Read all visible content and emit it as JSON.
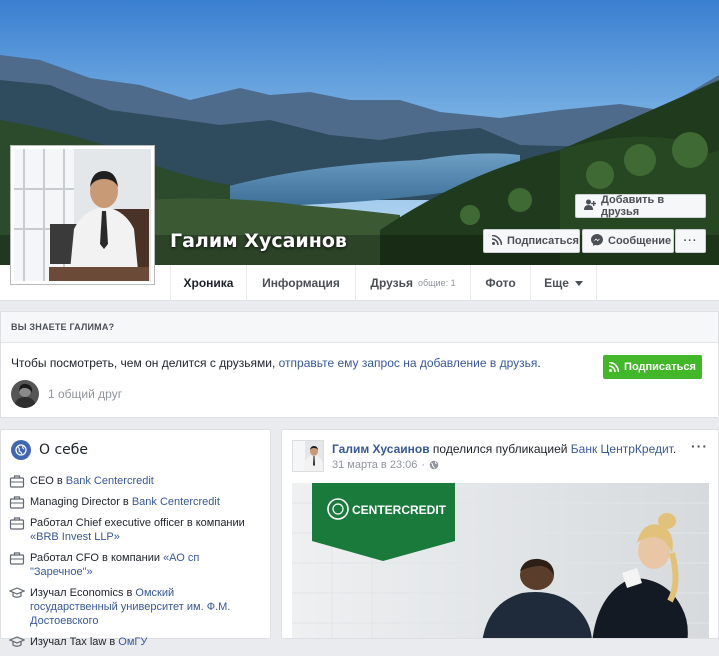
{
  "profile": {
    "name": "Галим Хусаинов"
  },
  "cover_actions": {
    "add_friend": "Добавить в друзья",
    "follow": "Подписаться",
    "message": "Сообщение",
    "more": "···"
  },
  "nav": {
    "tabs": [
      {
        "label": "Хроника"
      },
      {
        "label": "Информация"
      },
      {
        "label": "Друзья",
        "sub": "общие: 1"
      },
      {
        "label": "Фото"
      },
      {
        "label": "Еще"
      }
    ]
  },
  "know_box": {
    "heading": "ВЫ ЗНАЕТЕ ГАЛИМА?",
    "text_prefix": "Чтобы посмотреть, чем он делится с друзьями, ",
    "text_link": "отправьте ему запрос на добавление в друзья",
    "text_suffix": ".",
    "subscribe_button": "Подписаться",
    "mutual_friends": "1 общий друг"
  },
  "about": {
    "title": "О себе",
    "items": [
      {
        "icon": "briefcase-icon",
        "prefix": "CEO в ",
        "link": "Bank Centercredit",
        "suffix": ""
      },
      {
        "icon": "briefcase-icon",
        "prefix": "Managing Director в ",
        "link": "Bank Centercredit",
        "suffix": ""
      },
      {
        "icon": "briefcase-icon",
        "prefix": "Работал Chief executive officer в компании ",
        "link": "«BRB Invest LLP»",
        "suffix": ""
      },
      {
        "icon": "briefcase-icon",
        "prefix": "Работал CFO в компании ",
        "link": "«АО сп \"Заречное\"»",
        "suffix": ""
      },
      {
        "icon": "graduation-cap-icon",
        "prefix": "Изучал Economics в ",
        "link": "Омский государственный университет им. Ф.М. Достоевского",
        "suffix": ""
      },
      {
        "icon": "graduation-cap-icon",
        "prefix": "Изучал Tax law в ",
        "link": "ОмГУ",
        "suffix": ""
      }
    ]
  },
  "post": {
    "author": "Галим Хусаинов",
    "action": " поделился публикацией ",
    "page": "Банк ЦентрКредит",
    "action_end": ".",
    "date": "31 марта в 23:06",
    "privacy_icon": "globe-icon",
    "more": "···",
    "image_logo": "CENTERCREDIT"
  },
  "colors": {
    "link": "#365899",
    "green": "#42b72a",
    "brand_green": "#1a7a3c"
  }
}
